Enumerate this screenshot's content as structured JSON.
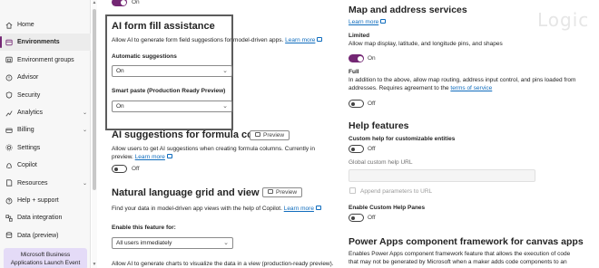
{
  "sidebar": {
    "items": [
      {
        "label": "Home",
        "icon": "home-icon",
        "active": false,
        "chevron": false
      },
      {
        "label": "Environments",
        "icon": "environments-icon",
        "active": true,
        "chevron": false
      },
      {
        "label": "Environment groups",
        "icon": "environment-groups-icon",
        "active": false,
        "chevron": false
      },
      {
        "label": "Advisor",
        "icon": "advisor-icon",
        "active": false,
        "chevron": false
      },
      {
        "label": "Security",
        "icon": "shield-icon",
        "active": false,
        "chevron": false
      },
      {
        "label": "Analytics",
        "icon": "analytics-icon",
        "active": false,
        "chevron": true
      },
      {
        "label": "Billing",
        "icon": "billing-icon",
        "active": false,
        "chevron": true
      },
      {
        "label": "Settings",
        "icon": "gear-icon",
        "active": false,
        "chevron": false
      },
      {
        "label": "Copilot",
        "icon": "copilot-icon",
        "active": false,
        "chevron": false
      },
      {
        "label": "Resources",
        "icon": "resources-icon",
        "active": false,
        "chevron": true
      },
      {
        "label": "Help + support",
        "icon": "help-icon",
        "active": false,
        "chevron": false
      },
      {
        "label": "Data integration",
        "icon": "data-integration-icon",
        "active": false,
        "chevron": false
      },
      {
        "label": "Data (preview)",
        "icon": "data-icon",
        "active": false,
        "chevron": false
      }
    ],
    "promo_line1": "Microsoft Business",
    "promo_line2": "Applications Launch Event"
  },
  "left": {
    "top_toggle_text": "On",
    "ai_form": {
      "title": "AI form fill assistance",
      "desc": "Allow AI to generate form field suggestions for model-driven apps.",
      "learn_more": "Learn more",
      "auto_label": "Automatic suggestions",
      "auto_value": "On",
      "paste_label": "Smart paste (Production Ready Preview)",
      "paste_value": "On"
    },
    "formula": {
      "title": "AI suggestions for formula columns",
      "preview": "Preview",
      "desc_line1": "Allow users to get AI suggestions when creating formula columns. Currently in",
      "desc_line2": "preview.",
      "learn_more": "Learn more",
      "toggle_text": "Off"
    },
    "nlgrid": {
      "title": "Natural language grid and view search",
      "preview": "Preview",
      "desc": "Find your data in model-driven app views with the help of Copilot.",
      "learn_more": "Learn more",
      "enable_label": "Enable this feature for:",
      "enable_value": "All users immediately",
      "charts_desc": "Allow AI to generate charts to visualize the data in a view (production-ready preview)."
    }
  },
  "right": {
    "map": {
      "title": "Map and address services",
      "learn_more": "Learn more",
      "limited_label": "Limited",
      "limited_desc": "Allow map display, latitude, and longitude pins, and shapes",
      "limited_toggle": "On",
      "full_label": "Full",
      "full_desc_line1": "In addition to the above, allow map routing, address input control, and pins loaded from",
      "full_desc_line2": "addresses. Requires agreement to the",
      "terms": "terms of service",
      "full_toggle": "Off"
    },
    "help": {
      "title": "Help features",
      "custom_label": "Custom help for customizable entities",
      "custom_toggle": "Off",
      "global_url_label": "Global custom help URL",
      "append_label": "Append parameters to URL",
      "panes_label": "Enable Custom Help Panes",
      "panes_toggle": "Off"
    },
    "pcf": {
      "title": "Power Apps component framework for canvas apps",
      "desc_line1": "Enables Power Apps component framework feature that allows the execution of code",
      "desc_line2": "that may not be generated by Microsoft when a maker adds code components to an"
    }
  },
  "watermark": "Logic"
}
